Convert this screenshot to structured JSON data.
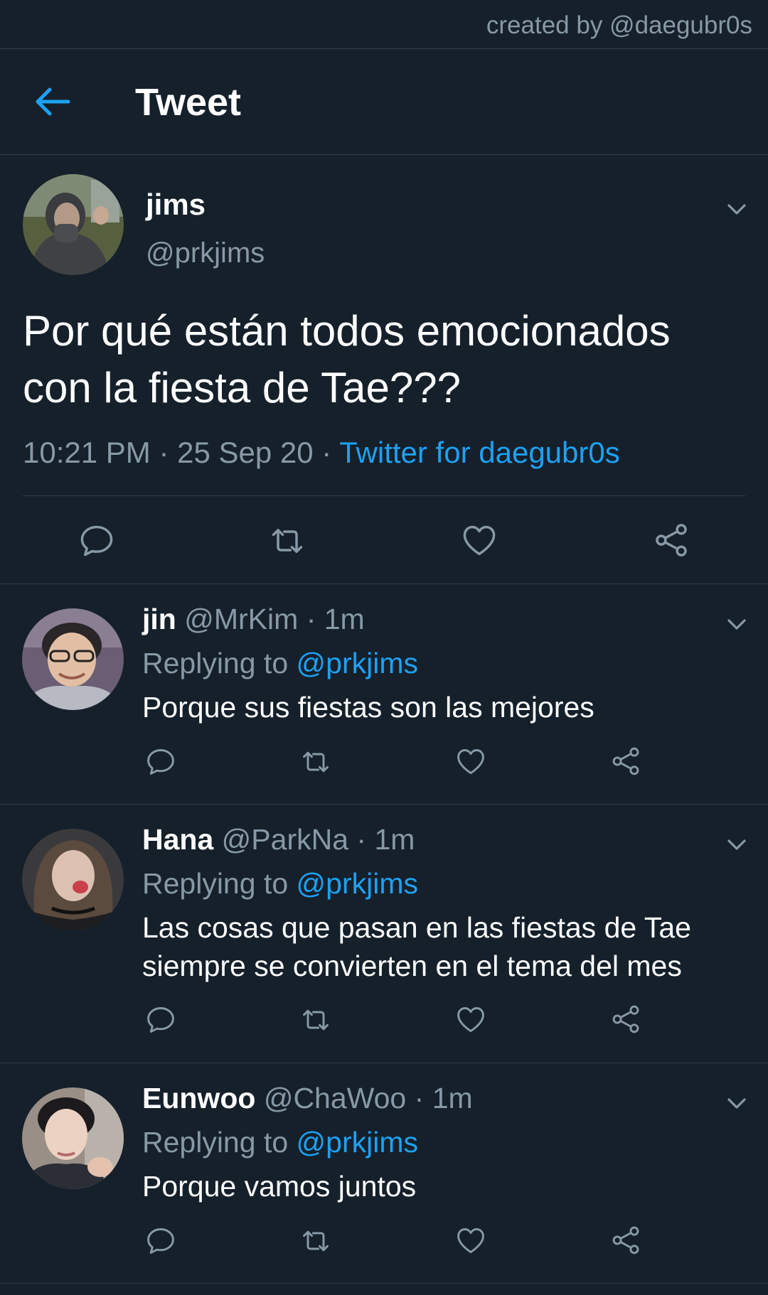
{
  "credit": "created by @daegubr0s",
  "header": {
    "title": "Tweet"
  },
  "main_tweet": {
    "name": "jims",
    "handle": "@prkjims",
    "text": "Por qué están todos emocionados con la fiesta de Tae???",
    "time": "10:21 PM",
    "date": "25 Sep 20",
    "source": "Twitter for daegubr0s"
  },
  "replies": [
    {
      "name": "jin",
      "handle": "@MrKim",
      "time": "1m",
      "replying_label": "Replying to",
      "replying_to": "@prkjims",
      "text": "Porque sus fiestas son las mejores"
    },
    {
      "name": "Hana",
      "handle": "@ParkNa",
      "time": "1m",
      "replying_label": "Replying to",
      "replying_to": "@prkjims",
      "text": "Las cosas que pasan en las fiestas de Tae siempre se convierten en el tema del mes"
    },
    {
      "name": "Eunwoo",
      "handle": "@ChaWoo",
      "time": "1m",
      "replying_label": "Replying to",
      "replying_to": "@prkjims",
      "text": "Porque vamos juntos"
    }
  ],
  "icons": {
    "back": "arrow-left-icon",
    "reply": "reply-bubble-icon",
    "retweet": "retweet-icon",
    "like": "heart-icon",
    "share": "share-icon",
    "more": "chevron-down-icon"
  },
  "colors": {
    "background": "#15202b",
    "accent": "#1da1f2",
    "secondary_text": "#8899a6",
    "divider": "#2f3c4a"
  }
}
